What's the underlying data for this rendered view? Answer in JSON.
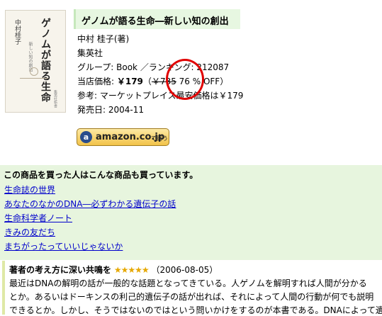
{
  "cover": {
    "title": "ゲノムが語る生命",
    "subtitle": "新しい知の創出",
    "author": "中村桂子",
    "publisher": "集英社新書"
  },
  "book": {
    "title": "ゲノムが語る生命―新しい知の創出",
    "author": "中村 桂子(著)",
    "publisher": "集英社",
    "group": "グループ: Book ／ランキング: 212087",
    "price_label": "当店価格: ",
    "price": "￥179",
    "price_open": "（",
    "orig_price": "￥735",
    "discount": " 76 % OFF）",
    "reference": "参考: マーケットプレイス最安価格は￥179",
    "release": "発売日: 2004-11"
  },
  "amazon_button": {
    "icon_letter": "a",
    "logo": "amazon.co.jp",
    "tail": "で買う"
  },
  "related": {
    "heading": "この商品を買った人はこんな商品も買っています。",
    "items": [
      "生命誌の世界",
      "あなたのなかのDNA―必ずわかる遺伝子の話",
      "生命科学者ノート",
      "きみの友だち",
      "まちがったっていいじゃないか"
    ]
  },
  "review": {
    "title": "著者の考え方に深い共鳴を",
    "stars": "★★★★★",
    "date": "（2006-08-05）",
    "lines": [
      "最近はDNAの解明の話が一般的な話題となってきている。人ゲノムを解明すれば人間が分かる",
      "とか。あるいはドーキンスの利己的遺伝子の話が出れば、それによって人間の行動が何でも説明",
      "できるとか。しかし、そうではないのではという問いかけをするのが本書である。DNAによって遺伝"
    ]
  },
  "colors": {
    "title_bg": "#e7f7e1",
    "related_bg": "#e7f5de",
    "link": "#0000cc",
    "annotation_circle": "#e00000",
    "stars": "#e6a800"
  }
}
